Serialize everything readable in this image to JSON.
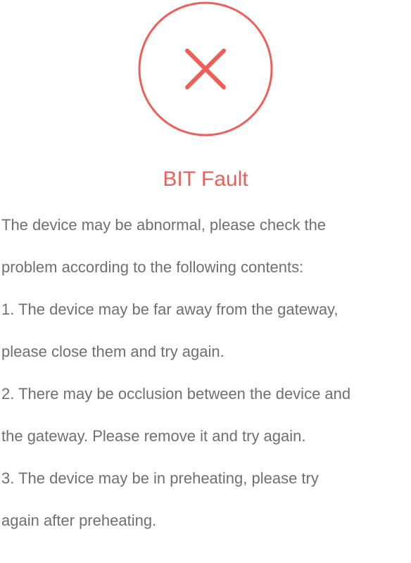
{
  "status": {
    "icon": "close-x-circle-icon",
    "accent_color": "#ef5f57",
    "title": "BIT Fault"
  },
  "message": {
    "text_color": "#6f6f6f",
    "lines": [
      "The device may be abnormal, please check the",
      "problem according to the following contents:",
      "1. The device may be far away from the gateway,",
      "please close them and try again.",
      "2. There may be occlusion between the device and",
      "the gateway. Please remove it and try again.",
      "3. The device may be in preheating, please try",
      "again after preheating."
    ]
  }
}
